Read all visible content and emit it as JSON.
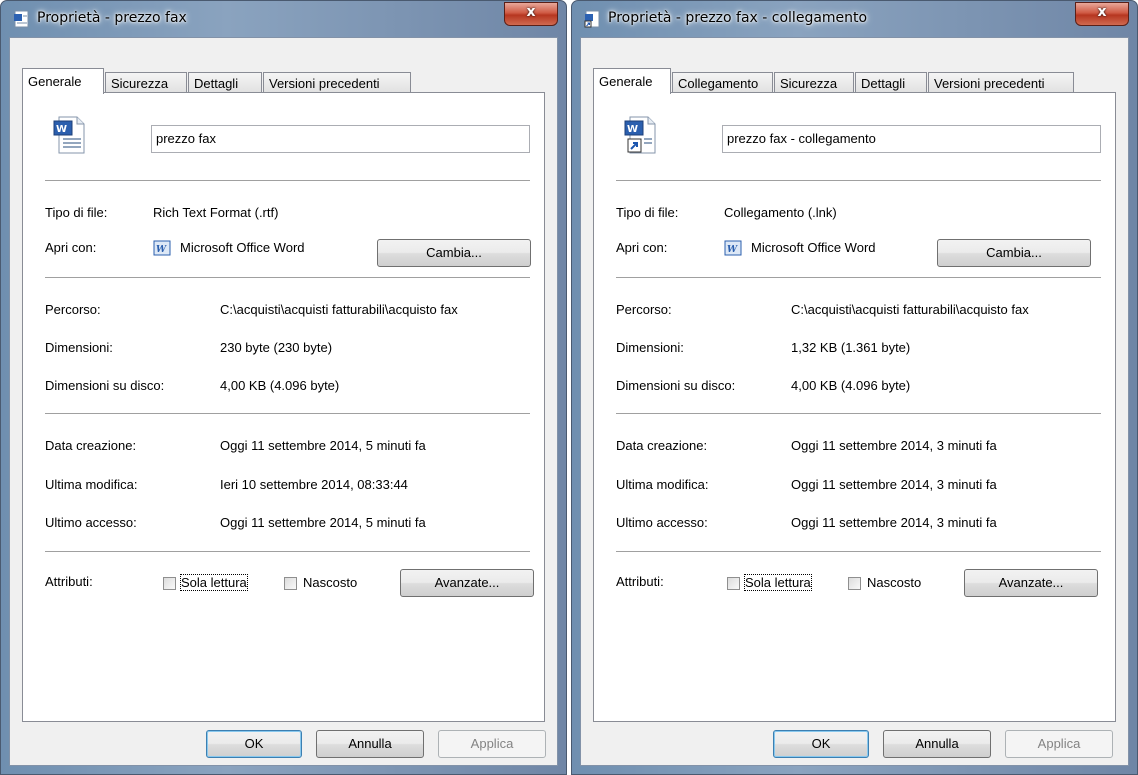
{
  "windows": [
    {
      "title": "Proprietà - prezzo fax",
      "tabs": [
        "Generale",
        "Sicurezza",
        "Dettagli",
        "Versioni precedenti"
      ],
      "file_name": "prezzo fax",
      "file_icon": "word-document-icon",
      "tipo_label": "Tipo di file:",
      "tipo_value": "Rich Text Format (.rtf)",
      "apri_label": "Apri con:",
      "apri_value": "Microsoft Office Word",
      "cambia": "Cambia...",
      "percorso_label": "Percorso:",
      "percorso_value": "C:\\acquisti\\acquisti fatturabili\\acquisto fax",
      "dim_label": "Dimensioni:",
      "dim_value": "230 byte (230 byte)",
      "disk_label": "Dimensioni su disco:",
      "disk_value": "4,00 KB (4.096 byte)",
      "creaz_label": "Data creazione:",
      "creaz_value": "Oggi 11 settembre 2014, 5 minuti fa",
      "mod_label": "Ultima modifica:",
      "mod_value": "Ieri 10 settembre 2014, 08:33:44",
      "acc_label": "Ultimo accesso:",
      "acc_value": "Oggi 11 settembre 2014, 5 minuti fa",
      "attr_label": "Attributi:",
      "readonly": "Sola lettura",
      "hidden": "Nascosto",
      "advanced": "Avanzate...",
      "ok": "OK",
      "cancel": "Annulla",
      "apply": "Applica"
    },
    {
      "title": "Proprietà - prezzo fax - collegamento",
      "tabs": [
        "Generale",
        "Collegamento",
        "Sicurezza",
        "Dettagli",
        "Versioni precedenti"
      ],
      "file_name": "prezzo fax - collegamento",
      "file_icon": "word-shortcut-icon",
      "tipo_label": "Tipo di file:",
      "tipo_value": "Collegamento (.lnk)",
      "apri_label": "Apri con:",
      "apri_value": "Microsoft Office Word",
      "cambia": "Cambia...",
      "percorso_label": "Percorso:",
      "percorso_value": "C:\\acquisti\\acquisti fatturabili\\acquisto fax",
      "dim_label": "Dimensioni:",
      "dim_value": "1,32 KB (1.361 byte)",
      "disk_label": "Dimensioni su disco:",
      "disk_value": "4,00 KB (4.096 byte)",
      "creaz_label": "Data creazione:",
      "creaz_value": "Oggi 11 settembre 2014, 3 minuti fa",
      "mod_label": "Ultima modifica:",
      "mod_value": "Oggi 11 settembre 2014, 3 minuti fa",
      "acc_label": "Ultimo accesso:",
      "acc_value": "Oggi 11 settembre 2014, 3 minuti fa",
      "attr_label": "Attributi:",
      "readonly": "Sola lettura",
      "hidden": "Nascosto",
      "advanced": "Avanzate...",
      "ok": "OK",
      "cancel": "Annulla",
      "apply": "Applica"
    }
  ],
  "colors": {
    "title_close": "#c4462f",
    "frame": "#7e99b8",
    "default_button_border": "#3c7fb1"
  },
  "close_glyph": "x"
}
